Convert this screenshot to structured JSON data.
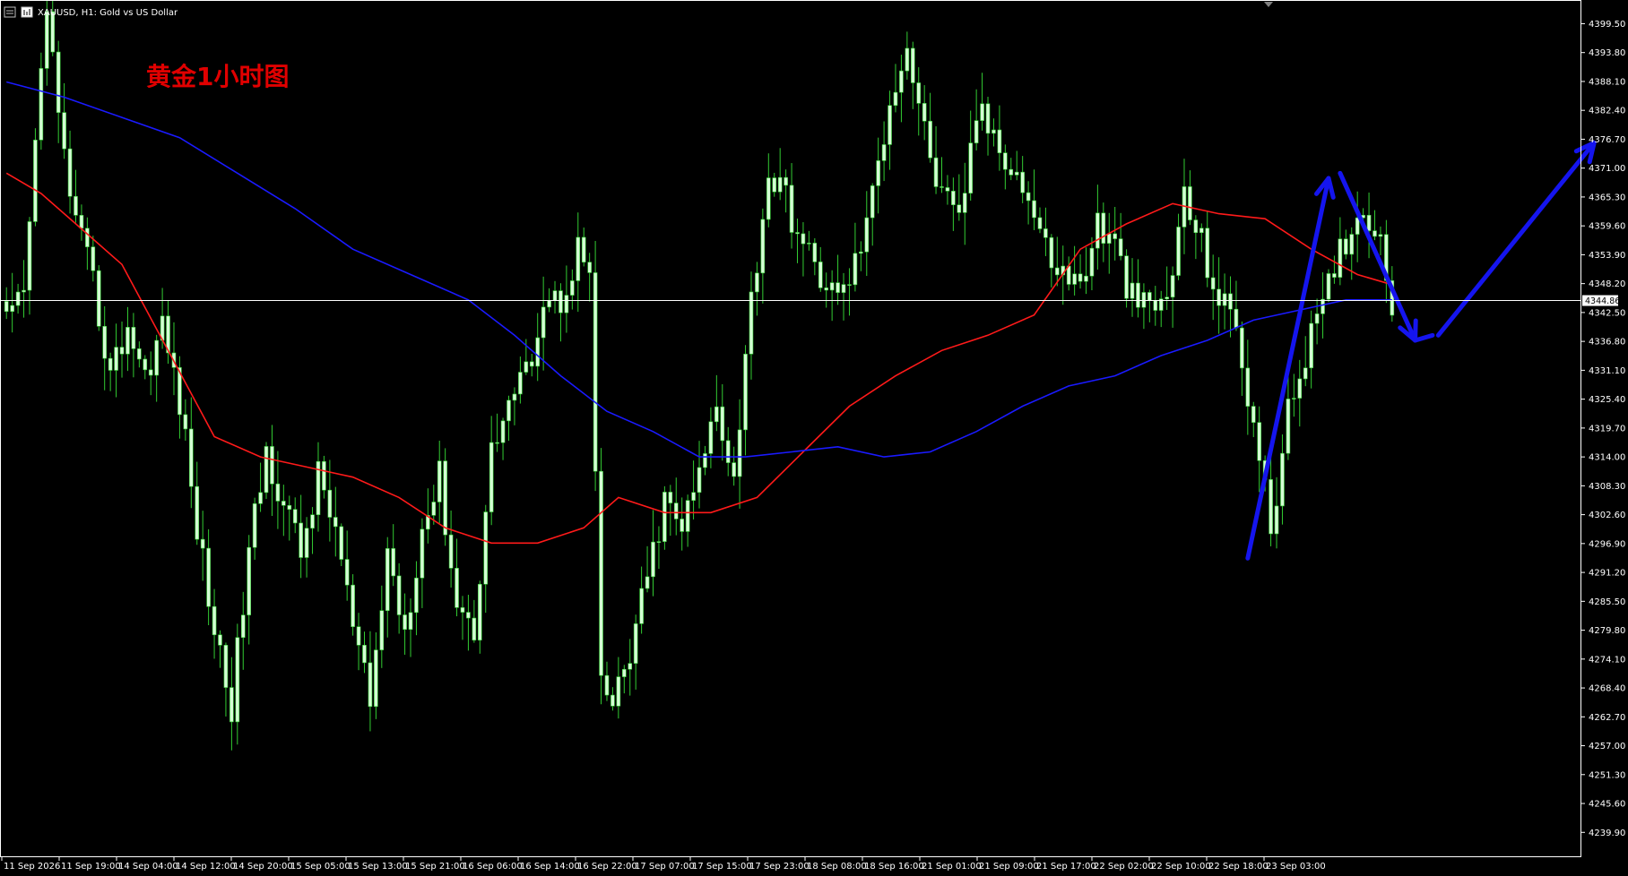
{
  "header": {
    "symbol_label": "XAUUSD, H1:  Gold vs US Dollar"
  },
  "overlay": {
    "title": "黄金1小时图",
    "title_color": "#e00000"
  },
  "colors": {
    "background": "#000000",
    "frame": "#ffffff",
    "candle_body": "#d4ffd4",
    "candle_wick": "#33cc33",
    "ma_fast": "#ff1a1a",
    "ma_slow": "#1a1aff",
    "arrow": "#1515ee",
    "price_line": "#ffffff",
    "price_tag_bg": "#ffffff",
    "price_tag_text": "#000000"
  },
  "chart_data": {
    "type": "candlestick",
    "symbol": "XAUUSD",
    "timeframe": "H1",
    "description": "Gold vs US Dollar",
    "ylim": [
      4235.0,
      4404.0
    ],
    "y_ticks": [
      "4399.50",
      "4393.80",
      "4388.10",
      "4382.40",
      "4376.70",
      "4371.00",
      "4365.30",
      "4359.60",
      "4353.90",
      "4348.20",
      "4342.50",
      "4336.80",
      "4331.10",
      "4325.40",
      "4319.70",
      "4314.00",
      "4308.30",
      "4302.60",
      "4296.90",
      "4291.20",
      "4285.50",
      "4279.80",
      "4274.10",
      "4268.40",
      "4262.70",
      "4257.00",
      "4251.30",
      "4245.60",
      "4239.90"
    ],
    "current_price": 4344.86,
    "current_price_label": "4344.86",
    "x_labels": [
      "11 Sep 2026",
      "11 Sep 19:00",
      "14 Sep 04:00",
      "14 Sep 12:00",
      "14 Sep 20:00",
      "15 Sep 05:00",
      "15 Sep 13:00",
      "15 Sep 21:00",
      "16 Sep 06:00",
      "16 Sep 14:00",
      "16 Sep 22:00",
      "17 Sep 07:00",
      "17 Sep 15:00",
      "17 Sep 23:00",
      "18 Sep 08:00",
      "18 Sep 16:00",
      "21 Sep 01:00",
      "21 Sep 09:00",
      "21 Sep 17:00",
      "22 Sep 02:00",
      "22 Sep 10:00",
      "22 Sep 18:00",
      "23 Sep 03:00"
    ],
    "price_anchors": [
      [
        0,
        4340
      ],
      [
        3,
        4345
      ],
      [
        5,
        4375
      ],
      [
        7,
        4405
      ],
      [
        9,
        4380
      ],
      [
        12,
        4360
      ],
      [
        15,
        4348
      ],
      [
        18,
        4330
      ],
      [
        21,
        4340
      ],
      [
        24,
        4330
      ],
      [
        27,
        4340
      ],
      [
        30,
        4325
      ],
      [
        33,
        4300
      ],
      [
        36,
        4280
      ],
      [
        39,
        4265
      ],
      [
        42,
        4295
      ],
      [
        45,
        4315
      ],
      [
        48,
        4305
      ],
      [
        51,
        4295
      ],
      [
        54,
        4310
      ],
      [
        57,
        4300
      ],
      [
        60,
        4280
      ],
      [
        63,
        4265
      ],
      [
        66,
        4295
      ],
      [
        69,
        4280
      ],
      [
        72,
        4300
      ],
      [
        75,
        4310
      ],
      [
        78,
        4285
      ],
      [
        81,
        4280
      ],
      [
        84,
        4315
      ],
      [
        87,
        4325
      ],
      [
        90,
        4330
      ],
      [
        93,
        4345
      ],
      [
        96,
        4345
      ],
      [
        99,
        4355
      ],
      [
        101,
        4350
      ],
      [
        103,
        4268
      ],
      [
        105,
        4265
      ],
      [
        108,
        4275
      ],
      [
        111,
        4290
      ],
      [
        114,
        4305
      ],
      [
        117,
        4300
      ],
      [
        120,
        4310
      ],
      [
        123,
        4325
      ],
      [
        126,
        4310
      ],
      [
        129,
        4345
      ],
      [
        132,
        4370
      ],
      [
        135,
        4365
      ],
      [
        138,
        4355
      ],
      [
        141,
        4350
      ],
      [
        144,
        4345
      ],
      [
        147,
        4352
      ],
      [
        150,
        4365
      ],
      [
        153,
        4385
      ],
      [
        156,
        4395
      ],
      [
        159,
        4378
      ],
      [
        162,
        4365
      ],
      [
        165,
        4360
      ],
      [
        168,
        4382
      ],
      [
        171,
        4378
      ],
      [
        174,
        4372
      ],
      [
        177,
        4365
      ],
      [
        180,
        4355
      ],
      [
        183,
        4350
      ],
      [
        186,
        4348
      ],
      [
        189,
        4360
      ],
      [
        192,
        4355
      ],
      [
        195,
        4345
      ],
      [
        198,
        4343
      ],
      [
        201,
        4345
      ],
      [
        204,
        4365
      ],
      [
        207,
        4356
      ],
      [
        210,
        4345
      ],
      [
        213,
        4340
      ],
      [
        216,
        4320
      ],
      [
        219,
        4300
      ],
      [
        222,
        4322
      ],
      [
        225,
        4335
      ],
      [
        228,
        4343
      ],
      [
        231,
        4355
      ],
      [
        234,
        4362
      ],
      [
        237,
        4361
      ],
      [
        240,
        4345
      ]
    ],
    "series": [
      {
        "name": "MA fast",
        "values": [
          [
            0,
            4370
          ],
          [
            6,
            4366
          ],
          [
            12,
            4360
          ],
          [
            20,
            4352
          ],
          [
            28,
            4335
          ],
          [
            36,
            4318
          ],
          [
            44,
            4314
          ],
          [
            52,
            4312
          ],
          [
            60,
            4310
          ],
          [
            68,
            4306
          ],
          [
            76,
            4300
          ],
          [
            84,
            4297
          ],
          [
            92,
            4297
          ],
          [
            100,
            4300
          ],
          [
            106,
            4306
          ],
          [
            114,
            4303
          ],
          [
            122,
            4303
          ],
          [
            130,
            4306
          ],
          [
            138,
            4315
          ],
          [
            146,
            4324
          ],
          [
            154,
            4330
          ],
          [
            162,
            4335
          ],
          [
            170,
            4338
          ],
          [
            178,
            4342
          ],
          [
            186,
            4355
          ],
          [
            194,
            4360
          ],
          [
            202,
            4364
          ],
          [
            210,
            4362
          ],
          [
            218,
            4361
          ],
          [
            226,
            4355
          ],
          [
            234,
            4350
          ],
          [
            240,
            4348
          ]
        ]
      },
      {
        "name": "MA slow",
        "values": [
          [
            0,
            4388
          ],
          [
            10,
            4385
          ],
          [
            20,
            4381
          ],
          [
            30,
            4377
          ],
          [
            40,
            4370
          ],
          [
            50,
            4363
          ],
          [
            60,
            4355
          ],
          [
            70,
            4350
          ],
          [
            80,
            4345
          ],
          [
            88,
            4338
          ],
          [
            96,
            4330
          ],
          [
            104,
            4323
          ],
          [
            112,
            4319
          ],
          [
            120,
            4314
          ],
          [
            128,
            4314
          ],
          [
            136,
            4315
          ],
          [
            144,
            4316
          ],
          [
            152,
            4314
          ],
          [
            160,
            4315
          ],
          [
            168,
            4319
          ],
          [
            176,
            4324
          ],
          [
            184,
            4328
          ],
          [
            192,
            4330
          ],
          [
            200,
            4334
          ],
          [
            208,
            4337
          ],
          [
            216,
            4341
          ],
          [
            224,
            4343
          ],
          [
            232,
            4345
          ],
          [
            240,
            4345
          ]
        ]
      }
    ],
    "annotations": [
      {
        "type": "arrow",
        "from": [
          215,
          4294
        ],
        "to": [
          229,
          4369
        ]
      },
      {
        "type": "arrow",
        "from": [
          231,
          4370
        ],
        "to": [
          244,
          4337
        ]
      },
      {
        "type": "line",
        "from": [
          244,
          4337
        ],
        "to": [
          247,
          4338
        ]
      },
      {
        "type": "arrow",
        "from": [
          248,
          4338
        ],
        "to": [
          275,
          4376
        ]
      }
    ]
  }
}
